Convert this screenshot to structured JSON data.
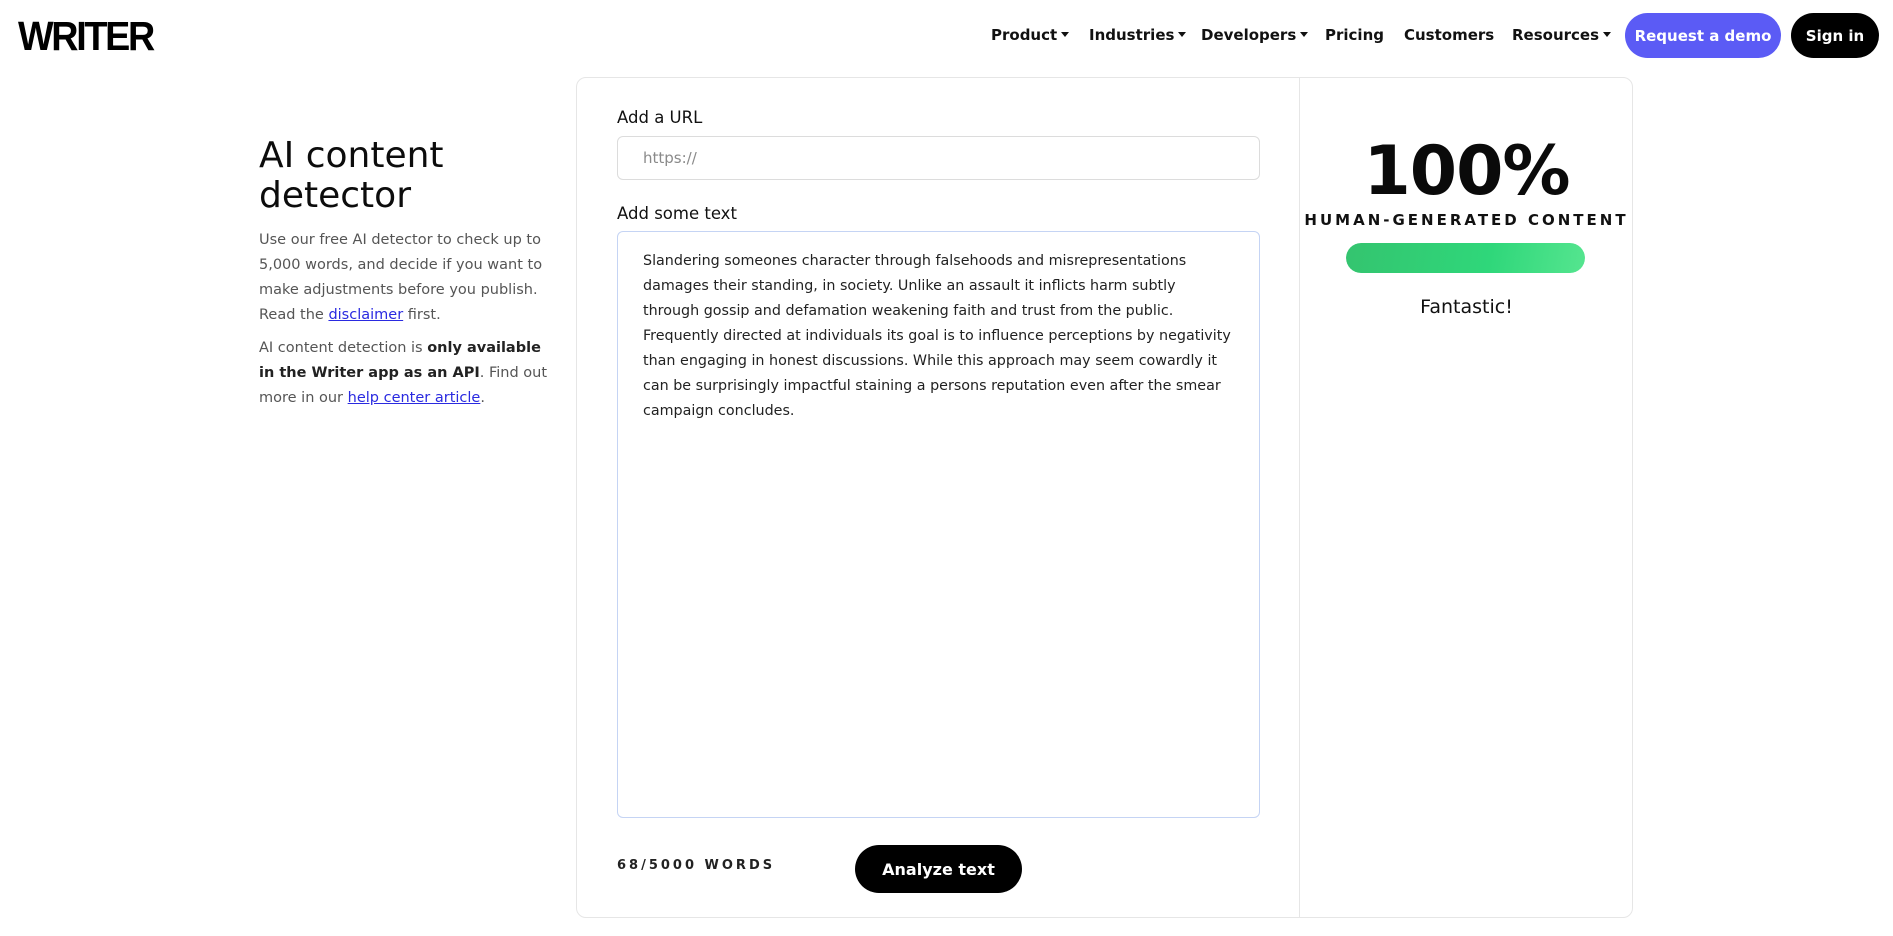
{
  "header": {
    "logo": "WRITER",
    "nav": [
      {
        "label": "Product",
        "has_caret": true
      },
      {
        "label": "Industries",
        "has_caret": true
      },
      {
        "label": "Developers",
        "has_caret": true
      },
      {
        "label": "Pricing",
        "has_caret": false
      },
      {
        "label": "Customers",
        "has_caret": false
      },
      {
        "label": "Resources",
        "has_caret": true
      }
    ],
    "demo_button": "Request a demo",
    "signin_button": "Sign in",
    "accent_color": "#5b5bf5"
  },
  "intro": {
    "title": "AI content detector",
    "p1_before": "Use our free AI detector to check up to 5,000 words, and decide if you want to make adjustments before you publish. Read the ",
    "p1_link": "disclaimer",
    "p1_after": " first.",
    "p2_before": "AI content detection is ",
    "p2_bold": "only available in the Writer app as an API",
    "p2_middle": ". Find out more in our ",
    "p2_link": "help center article",
    "p2_after": "."
  },
  "form": {
    "url_label": "Add a URL",
    "url_placeholder": "https://",
    "url_value": "",
    "text_label": "Add some text",
    "text_value": "Slandering someones character through falsehoods and misrepresentations damages their standing, in society. Unlike an assault it inflicts harm subtly through gossip and defamation weakening faith and trust from the public. Frequently directed at individuals its goal is to influence perceptions by negativity than engaging in honest discussions. While this approach may seem cowardly it can be surprisingly impactful staining a persons reputation even after the smear campaign concludes.",
    "word_count": "68/5000 WORDS",
    "analyze_button": "Analyze text"
  },
  "result": {
    "score": "100%",
    "score_label": "HUMAN-GENERATED CONTENT",
    "human_fraction": 1.0,
    "bar_color": "#2fd77a",
    "verdict": "Fantastic!"
  }
}
